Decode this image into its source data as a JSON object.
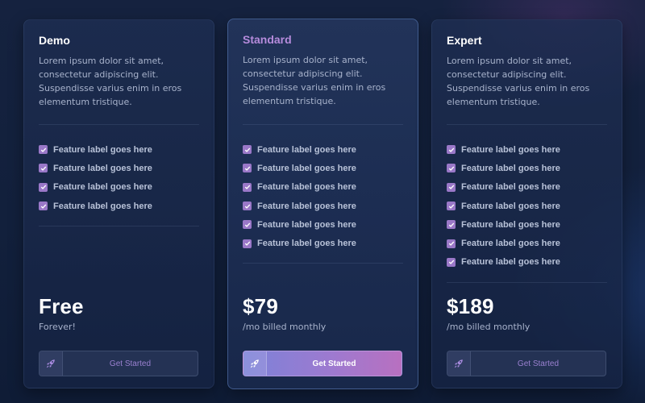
{
  "plans": [
    {
      "title": "Demo",
      "description": "Lorem ipsum dolor sit amet, consectetur adipiscing elit. Suspendisse varius enim in eros elementum tristique.",
      "features": [
        "Feature label goes here",
        "Feature label goes here",
        "Feature label goes here",
        "Feature label goes here"
      ],
      "price": "Free",
      "price_sub": "Forever!",
      "cta_label": "Get Started",
      "cta_icon": "rocket-icon"
    },
    {
      "title": "Standard",
      "description": "Lorem ipsum dolor sit amet, consectetur adipiscing elit. Suspendisse varius enim in eros elementum tristique.",
      "features": [
        "Feature label goes here",
        "Feature label goes here",
        "Feature label goes here",
        "Feature label goes here",
        "Feature label goes here",
        "Feature label goes here"
      ],
      "price": "$79",
      "price_sub": "/mo billed monthly",
      "cta_label": "Get Started",
      "cta_icon": "rocket-icon"
    },
    {
      "title": "Expert",
      "description": "Lorem ipsum dolor sit amet, consectetur adipiscing elit. Suspendisse varius enim in eros elementum tristique.",
      "features": [
        "Feature label goes here",
        "Feature label goes here",
        "Feature label goes here",
        "Feature label goes here",
        "Feature label goes here",
        "Feature label goes here",
        "Feature label goes here"
      ],
      "price": "$189",
      "price_sub": "/mo billed monthly",
      "cta_label": "Get Started",
      "cta_icon": "rocket-icon"
    }
  ],
  "colors": {
    "background": "#12203c",
    "accent": "#9d7ad0",
    "featured_title": "#b68bdc",
    "check": "#9a78c8"
  }
}
